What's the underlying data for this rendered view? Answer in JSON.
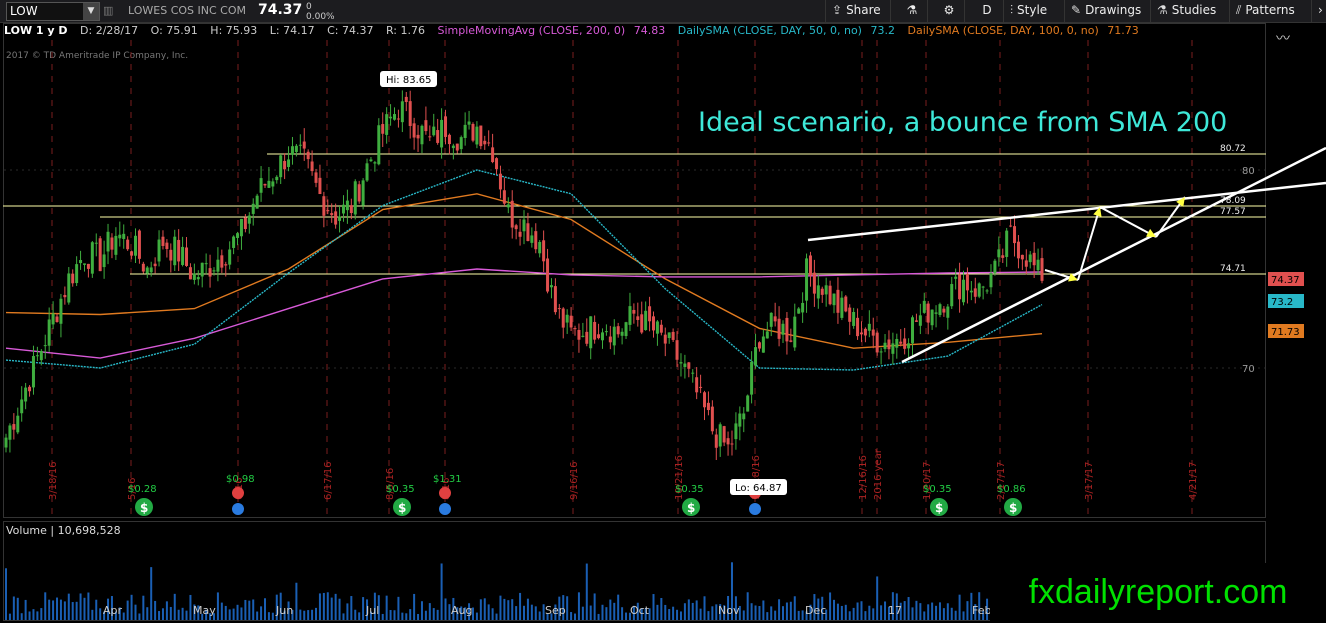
{
  "topbar": {
    "symbol": "LOW",
    "company": "LOWES COS INC COM",
    "price": "74.37",
    "change_top": "0",
    "change_pct": "0.00%",
    "share": "Share",
    "period": "D",
    "style": "Style",
    "drawings": "Drawings",
    "studies": "Studies",
    "patterns": "Patterns"
  },
  "infobar": {
    "title": "LOW 1 y D",
    "date": "D: 2/28/17",
    "open": "O: 75.91",
    "high": "H: 75.93",
    "low": "L: 74.17",
    "close": "C: 74.37",
    "range": "R: 1.76",
    "sma200_name": "SimpleMovingAvg (CLOSE, 200, 0)",
    "sma200_val": "74.83",
    "sma50_name": "DailySMA (CLOSE, DAY, 50, 0, no)",
    "sma50_val": "73.2",
    "sma100_name": "DailySMA (CLOSE, DAY, 100, 0, no)",
    "sma100_val": "71.73"
  },
  "copyright": "2017 © TD Ameritrade IP Company, Inc.",
  "annotation": "Ideal scenario, a bounce from SMA 200",
  "hi_label": "Hi: 83.65",
  "lo_label": "Lo: 64.87",
  "volume": {
    "label": "Volume",
    "value": "10,698,528"
  },
  "brand": "fxdailyreport.com",
  "colors": {
    "up": "#3fae3f",
    "down": "#e0504f",
    "sma200": "#d85ad8",
    "sma50": "#28b8c8",
    "sma100": "#e07a20",
    "lines": "#ffffaa"
  },
  "chart_data": {
    "type": "candlestick",
    "symbol": "LOW",
    "period": "1 y D",
    "ylim": [
      62,
      88
    ],
    "y_ticks": [
      70,
      80
    ],
    "x_ticks": [
      "Apr",
      "May",
      "Jun",
      "Jul",
      "Aug",
      "Sep",
      "Oct",
      "Nov",
      "Dec",
      "17",
      "Feb"
    ],
    "price_levels": [
      "80.72",
      "78.09",
      "77.57",
      "74.71"
    ],
    "price_badges": [
      {
        "label": "74.37",
        "color": "#e0504f"
      },
      {
        "label": "73.2",
        "color": "#28b8c8"
      },
      {
        "label": "71.73",
        "color": "#e07a20"
      }
    ],
    "events": [
      {
        "date": "3/18/16"
      },
      {
        "date": "5/16",
        "eps": "$0.28",
        "type": "earnings"
      },
      {
        "date": "6/16",
        "dividend": "$0.98",
        "type": "dividend"
      },
      {
        "date": "6/17/16"
      },
      {
        "date": "8/5/16",
        "eps": "$0.35",
        "type": "earnings"
      },
      {
        "date": "8/16",
        "dividend": "$1.31",
        "type": "dividend"
      },
      {
        "date": "9/16/16"
      },
      {
        "date": "10/21/16",
        "eps": "$0.35",
        "type": "earnings"
      },
      {
        "date": "11/18/16",
        "type": "dividend"
      },
      {
        "date": "12/16/16"
      },
      {
        "date": "2016 year"
      },
      {
        "date": "1/20/17",
        "eps": "$0.35",
        "type": "earnings"
      },
      {
        "date": "2/17/17",
        "eps": "$0.86",
        "type": "earnings"
      },
      {
        "date": "3/17/17"
      },
      {
        "date": "4/21/17"
      }
    ],
    "close_series": [
      66.5,
      68.5,
      70.5,
      72.5,
      74.5,
      75.8,
      75.5,
      76.8,
      76.2,
      75.0,
      76.4,
      75.8,
      74.6,
      75.2,
      75.9,
      76.8,
      78.8,
      79.8,
      80.9,
      80.4,
      78.7,
      77.7,
      78.2,
      80.2,
      81.9,
      83.2,
      82.4,
      81.4,
      82.2,
      81.6,
      82.2,
      81.1,
      77.8,
      77.3,
      76.4,
      72.9,
      71.7,
      71.9,
      72.3,
      71.8,
      72.7,
      72.1,
      71.3,
      70.3,
      68.7,
      66.9,
      65.9,
      67.7,
      71.7,
      72.1,
      71.8,
      74.8,
      74.2,
      73.1,
      72.3,
      71.6,
      71.3,
      71.5,
      72.4,
      73.1,
      73.7,
      74.4,
      73.9,
      74.8,
      76.7,
      75.7,
      74.4
    ],
    "sma200": [
      71.0,
      70.5,
      71.5,
      73.0,
      74.5,
      75.0,
      74.7,
      74.6,
      74.6,
      74.7,
      74.8,
      74.85
    ],
    "sma50": [
      70.4,
      70.0,
      71.2,
      74.8,
      78.2,
      80.0,
      78.8,
      74.0,
      70.0,
      69.9,
      70.6,
      73.2
    ],
    "sma100": [
      72.8,
      72.7,
      73.0,
      75.0,
      78.0,
      78.8,
      77.5,
      74.5,
      72.0,
      71.0,
      71.3,
      71.73
    ]
  }
}
